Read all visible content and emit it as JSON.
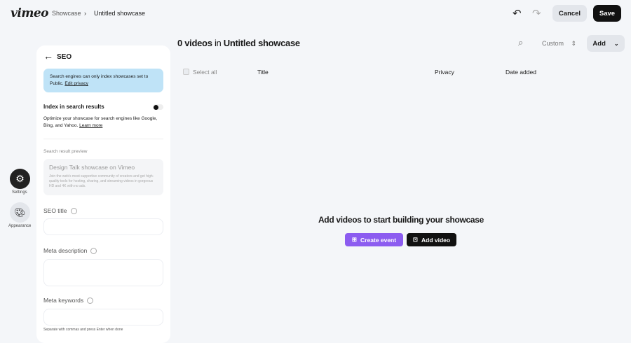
{
  "header": {
    "logo": "vimeo",
    "breadcrumb": [
      "Showcase",
      "Untitled showcase"
    ],
    "cancel": "Cancel",
    "save": "Save"
  },
  "rail": {
    "settings": "Settings",
    "appearance": "Appearance"
  },
  "seo": {
    "title": "SEO",
    "notice": "Search engines can only index showcases set to Public.",
    "edit_privacy": "Edit privacy",
    "index_label": "Index in search results",
    "index_desc": "Optimize your showcase for search engines like Google, Bing, and Yahoo.",
    "learn_more": "Learn more",
    "preview_label": "Search result preview",
    "preview_title": "Design Talk showcase on Vimeo",
    "preview_desc": "Join the web's most supportive community of creators and get high-quality tools for hosting, sharing, and streaming videos in gorgeous HD and 4K with no ads.",
    "seo_title_label": "SEO title",
    "meta_desc_label": "Meta description",
    "meta_keywords_label": "Meta keywords",
    "keywords_hint": "Separate with commas and press Enter when done"
  },
  "main": {
    "count": "0 videos",
    "in": "in",
    "showcase_name": "Untitled showcase",
    "sort": "Custom",
    "add": "Add",
    "select_all": "Select all",
    "columns": [
      "Title",
      "Privacy",
      "Date added"
    ],
    "empty_title": "Add videos to start building your showcase",
    "create_event": "Create event",
    "add_video": "Add video"
  },
  "colors": {
    "accent": "#8c5cf0",
    "notice": "#bfe3f7",
    "dark": "#111111"
  }
}
